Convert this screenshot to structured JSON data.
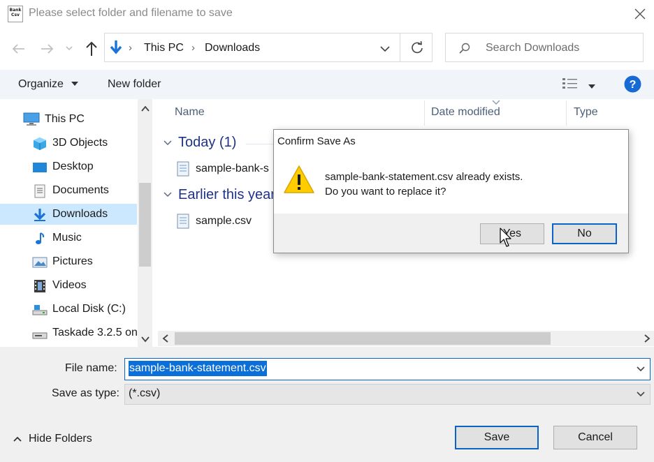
{
  "window": {
    "title": "Please select folder and filename to save",
    "app_icon_text": "Bank Csv"
  },
  "address": {
    "path": [
      "This PC",
      "Downloads"
    ]
  },
  "search": {
    "placeholder": "Search Downloads"
  },
  "toolbar": {
    "organize": "Organize",
    "new_folder": "New folder"
  },
  "nav": {
    "items": [
      {
        "label": "This PC",
        "icon": "computer-icon"
      },
      {
        "label": "3D Objects",
        "icon": "cube-icon"
      },
      {
        "label": "Desktop",
        "icon": "desktop-icon"
      },
      {
        "label": "Documents",
        "icon": "documents-icon"
      },
      {
        "label": "Downloads",
        "icon": "download-icon",
        "selected": true
      },
      {
        "label": "Music",
        "icon": "music-icon"
      },
      {
        "label": "Pictures",
        "icon": "pictures-icon"
      },
      {
        "label": "Videos",
        "icon": "videos-icon"
      },
      {
        "label": "Local Disk (C:)",
        "icon": "drive-icon"
      },
      {
        "label": "Taskade 3.2.5 on",
        "icon": "drive-icon"
      }
    ]
  },
  "columns": {
    "name": "Name",
    "date_modified": "Date modified",
    "type": "Type"
  },
  "groups": [
    {
      "header": "Today (1)",
      "files": [
        "sample-bank-s"
      ]
    },
    {
      "header": "Earlier this year",
      "files": [
        "sample.csv"
      ]
    }
  ],
  "form": {
    "filename_label": "File name:",
    "filename_value": "sample-bank-statement.csv",
    "type_label": "Save as type:",
    "type_value": "(*.csv)",
    "hide_folders": "Hide Folders",
    "save": "Save",
    "cancel": "Cancel"
  },
  "confirm": {
    "title": "Confirm Save As",
    "message_line1": "sample-bank-statement.csv already exists.",
    "message_line2": "Do you want to replace it?",
    "yes": "Yes",
    "no": "No"
  },
  "colors": {
    "accent": "#0a64c8",
    "selection": "#cce8ff",
    "group_header": "#1e3287",
    "warning": "#ffcc00"
  }
}
